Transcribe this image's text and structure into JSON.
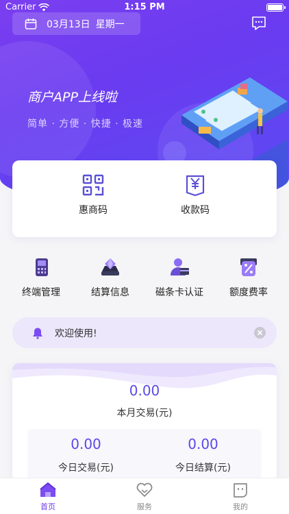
{
  "status_bar": {
    "carrier": "Carrier",
    "time": "1:15 PM"
  },
  "header": {
    "date": "03月13日",
    "weekday": "星期一"
  },
  "banner": {
    "title": "商户APP上线啦",
    "subtitle": "简单 · 方便 · 快捷 · 极速"
  },
  "codes": [
    {
      "label": "惠商码",
      "icon": "qr-code-icon"
    },
    {
      "label": "收款码",
      "icon": "yen-receipt-icon"
    }
  ],
  "functions": [
    {
      "label": "终端管理",
      "icon": "pos-terminal-icon"
    },
    {
      "label": "结算信息",
      "icon": "settlement-diamond-icon"
    },
    {
      "label": "磁条卡认证",
      "icon": "user-card-icon"
    },
    {
      "label": "额度费率",
      "icon": "percent-rate-icon"
    }
  ],
  "notice": {
    "text": "欢迎使用!"
  },
  "stats": {
    "month_value": "0.00",
    "month_label": "本月交易(元)",
    "today_trade_value": "0.00",
    "today_trade_label": "今日交易(元)",
    "today_settle_value": "0.00",
    "today_settle_label": "今日结算(元)"
  },
  "tabs": [
    {
      "label": "首页",
      "icon": "home-icon",
      "active": true
    },
    {
      "label": "服务",
      "icon": "heart-icon",
      "active": false
    },
    {
      "label": "我的",
      "icon": "profile-icon",
      "active": false
    }
  ],
  "colors": {
    "primary": "#6a3bf0",
    "accent_value": "#5b49e8",
    "notice_bg": "#ece7fb"
  }
}
